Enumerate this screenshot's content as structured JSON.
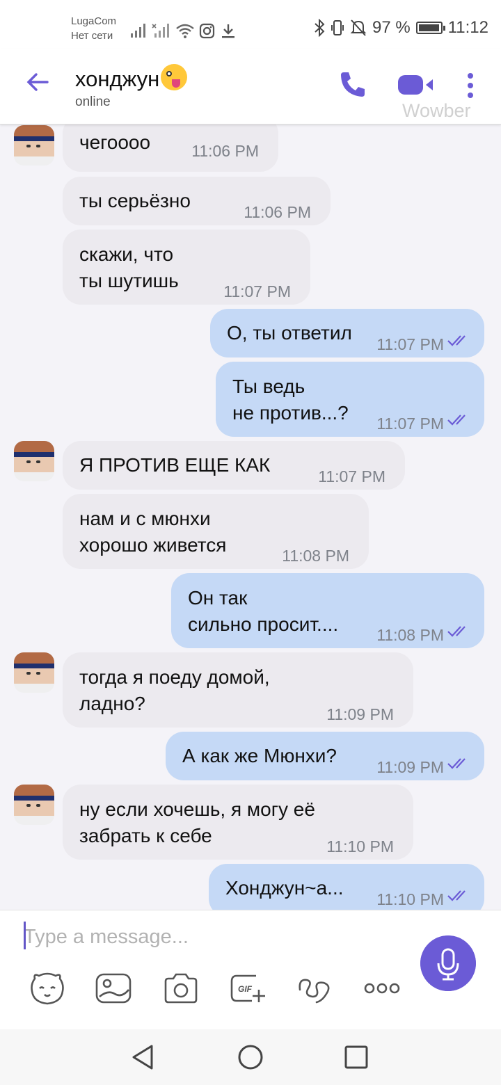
{
  "status_bar": {
    "carrier_name": "LugaCom",
    "carrier_status": "Нет сети",
    "battery_text": "97 %",
    "battery_level": 0.97,
    "clock": "11:12"
  },
  "header": {
    "contact_name": "хонджун",
    "status": "online",
    "watermark": "Wowber",
    "accent_color": "#6b5bd6"
  },
  "messages": [
    {
      "direction": "in",
      "text": "чегоооо",
      "time": "11:06 PM"
    },
    {
      "direction": "in",
      "text": "ты серьёзно",
      "time": "11:06 PM"
    },
    {
      "direction": "in",
      "text": "скажи, что\nты шутишь",
      "time": "11:07 PM"
    },
    {
      "direction": "out",
      "text": "О, ты ответил",
      "time": "11:07 PM",
      "read": true
    },
    {
      "direction": "out",
      "text": "Ты ведь\nне против...?",
      "time": "11:07 PM",
      "read": true
    },
    {
      "direction": "in",
      "text": "Я ПРОТИВ ЕЩЕ КАК",
      "time": "11:07 PM"
    },
    {
      "direction": "in",
      "text": "нам и с мюнхи\nхорошо живется",
      "time": "11:08 PM"
    },
    {
      "direction": "out",
      "text": "Он так\nсильно просит....",
      "time": "11:08 PM",
      "read": true
    },
    {
      "direction": "in",
      "text": "тогда я поеду домой,\nладно?",
      "time": "11:09 PM"
    },
    {
      "direction": "out",
      "text": "А как же Мюнхи?",
      "time": "11:09 PM",
      "read": true
    },
    {
      "direction": "in",
      "text": "ну если хочешь, я могу её\nзабрать к себе",
      "time": "11:10 PM"
    },
    {
      "direction": "out",
      "text": "Хонджун~а...",
      "time": "11:10 PM",
      "read": true
    }
  ],
  "composer": {
    "placeholder": "Type a message...",
    "tools": [
      "sticker-icon",
      "gallery-icon",
      "camera-icon",
      "gif-icon",
      "doodle-icon",
      "more-icon"
    ]
  },
  "navigation": [
    "back-nav-icon",
    "home-nav-icon",
    "recents-nav-icon"
  ]
}
